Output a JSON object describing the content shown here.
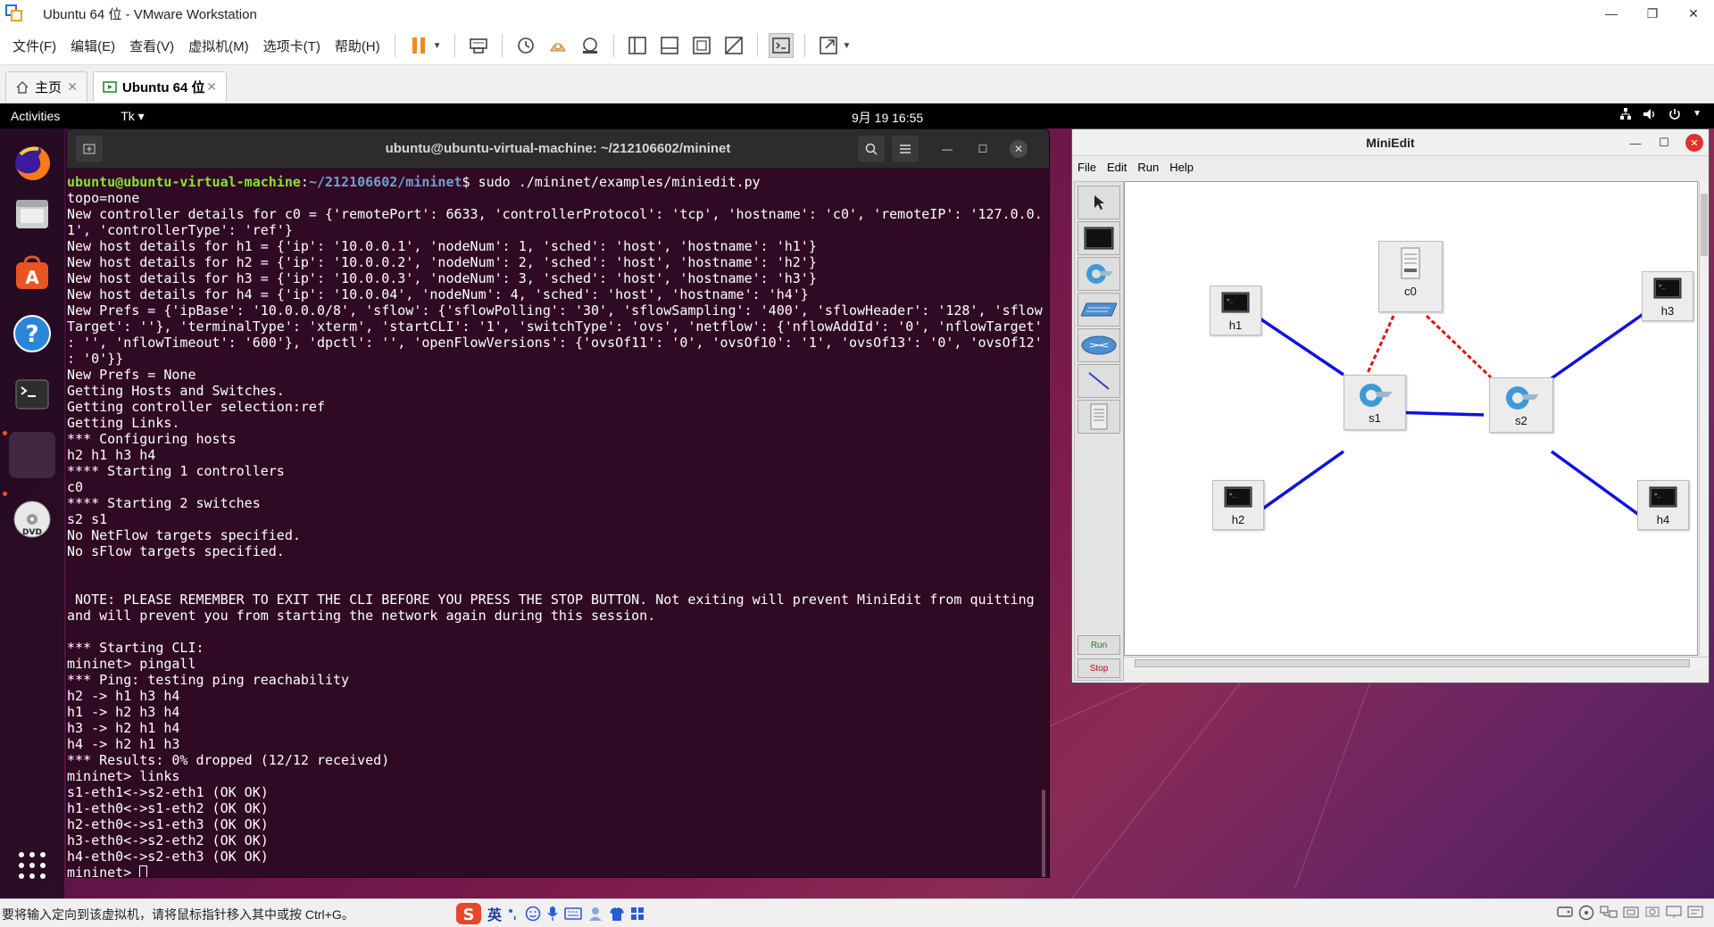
{
  "window": {
    "title": "Ubuntu 64 位 - VMware Workstation",
    "controls": [
      "—",
      "❐",
      "✕"
    ]
  },
  "menu": [
    "文件(F)",
    "编辑(E)",
    "查看(V)",
    "虚拟机(M)",
    "选项卡(T)",
    "帮助(H)"
  ],
  "toolbar_icons": [
    "pause-icon",
    "send-ctrl-alt-del-icon",
    "snapshot-icon",
    "revert-snapshot-icon",
    "snapshot-manager-icon",
    "library-icon",
    "thumbnail-icon",
    "fullscreen-icon",
    "unity-icon",
    "console-view-icon",
    "stretch-icon"
  ],
  "tabs": [
    {
      "label": "主页",
      "close": "✕"
    },
    {
      "label": "Ubuntu 64 位",
      "close": "✕"
    }
  ],
  "guest": {
    "topbar": {
      "activities": "Activities",
      "appmenu": "Tk ▾",
      "clock": "9月 19  16:55"
    },
    "terminal": {
      "title": "ubuntu@ubuntu-virtual-machine: ~/212106602/mininet",
      "prompt_user": "ubuntu@ubuntu-virtual-machine",
      "prompt_path": "~/212106602/mininet",
      "command": "$ sudo ./mininet/examples/miniedit.py",
      "lines": [
        "topo=none",
        "New controller details for c0 = {'remotePort': 6633, 'controllerProtocol': 'tcp', 'hostname': 'c0', 'remoteIP': '127.0.0.",
        "1', 'controllerType': 'ref'}",
        "New host details for h1 = {'ip': '10.0.0.1', 'nodeNum': 1, 'sched': 'host', 'hostname': 'h1'}",
        "New host details for h2 = {'ip': '10.0.0.2', 'nodeNum': 2, 'sched': 'host', 'hostname': 'h2'}",
        "New host details for h3 = {'ip': '10.0.0.3', 'nodeNum': 3, 'sched': 'host', 'hostname': 'h3'}",
        "New host details for h4 = {'ip': '10.0.04', 'nodeNum': 4, 'sched': 'host', 'hostname': 'h4'}",
        "New Prefs = {'ipBase': '10.0.0.0/8', 'sflow': {'sflowPolling': '30', 'sflowSampling': '400', 'sflowHeader': '128', 'sflow",
        "Target': ''}, 'terminalType': 'xterm', 'startCLI': '1', 'switchType': 'ovs', 'netflow': {'nflowAddId': '0', 'nflowTarget'",
        ": '', 'nflowTimeout': '600'}, 'dpctl': '', 'openFlowVersions': {'ovsOf11': '0', 'ovsOf10': '1', 'ovsOf13': '0', 'ovsOf12'",
        ": '0'}}",
        "New Prefs = None",
        "Getting Hosts and Switches.",
        "Getting controller selection:ref",
        "Getting Links.",
        "*** Configuring hosts",
        "h2 h1 h3 h4",
        "**** Starting 1 controllers",
        "c0",
        "**** Starting 2 switches",
        "s2 s1",
        "No NetFlow targets specified.",
        "No sFlow targets specified.",
        "",
        "",
        " NOTE: PLEASE REMEMBER TO EXIT THE CLI BEFORE YOU PRESS THE STOP BUTTON. Not exiting will prevent MiniEdit from quitting",
        "and will prevent you from starting the network again during this session.",
        "",
        "*** Starting CLI:",
        "mininet> pingall",
        "*** Ping: testing ping reachability",
        "h2 -> h1 h3 h4",
        "h1 -> h2 h3 h4",
        "h3 -> h2 h1 h4",
        "h4 -> h2 h1 h3",
        "*** Results: 0% dropped (12/12 received)",
        "mininet> links",
        "s1-eth1<->s2-eth1 (OK OK)",
        "h1-eth0<->s1-eth2 (OK OK)",
        "h2-eth0<->s1-eth3 (OK OK)",
        "h3-eth0<->s2-eth2 (OK OK)",
        "h4-eth0<->s2-eth3 (OK OK)"
      ],
      "final_prompt": "mininet> "
    },
    "miniedit": {
      "title": "MiniEdit",
      "menu": [
        "File",
        "Edit",
        "Run",
        "Help"
      ],
      "run_label": "Run",
      "stop_label": "Stop",
      "nodes": {
        "h1": "h1",
        "h2": "h2",
        "h3": "h3",
        "h4": "h4",
        "s1": "s1",
        "s2": "s2",
        "c0": "c0"
      },
      "link_color": "#1010e0",
      "controller_link_color": "#e01010"
    }
  },
  "status": {
    "message": "要将输入定向到该虚拟机，请将鼠标指针移入其中或按 Ctrl+G。",
    "ime_label": "英"
  },
  "colors": {
    "terminal_bg": "#300a24",
    "prompt_user": "#8ae234",
    "prompt_path": "#729fcf",
    "ubuntu_orange": "#e95420"
  }
}
